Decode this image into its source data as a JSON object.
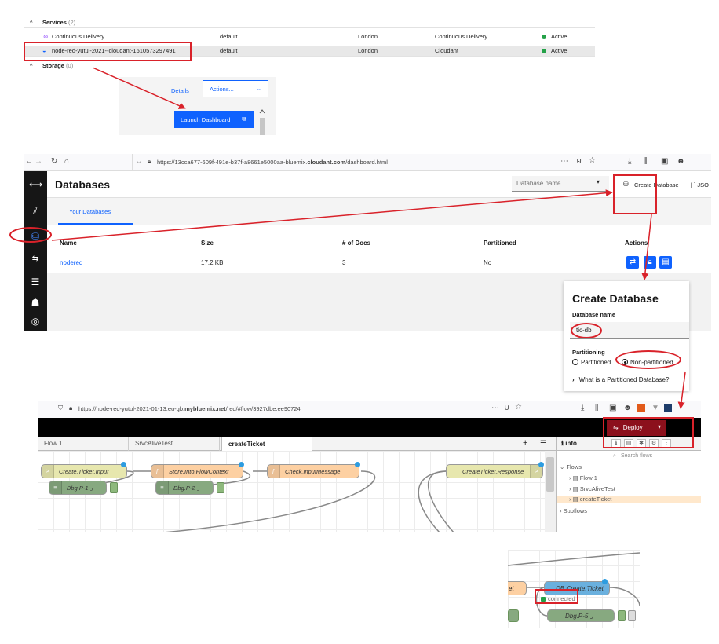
{
  "resource_list": {
    "services_header": "Services",
    "services_count": "(2)",
    "storage_header": "Storage",
    "storage_count": "(0)",
    "rows": [
      {
        "name": "Continuous Delivery",
        "group": "default",
        "location": "London",
        "offering": "Continuous Delivery",
        "status": "Active"
      },
      {
        "name": "node-red-yutul-2021--cloudant-1610573297491",
        "group": "default",
        "location": "London",
        "offering": "Cloudant",
        "status": "Active"
      }
    ],
    "details_label": "Details",
    "actions_label": "Actions...",
    "launch_label": "Launch Dashboard",
    "status_color": "#24a148"
  },
  "cloudant": {
    "url": "https://13cca677-609f-491e-b37f-a8661e5000aa-bluemix.cloudant.com/dashboard.html",
    "url_prefix": "https://13cca677-609f-491e-b37f-a8661e5000aa-bluemix.",
    "url_bold": "cloudant.com",
    "url_suffix": "/dashboard.html",
    "page_title": "Databases",
    "db_name_placeholder": "Database name",
    "create_label": "Create Database",
    "json_label": "[ ] JSO",
    "tab_label": "Your Databases",
    "columns": [
      "Name",
      "Size",
      "# of Docs",
      "Partitioned",
      "Actions"
    ],
    "row": {
      "name": "nodered",
      "size": "17.2 KB",
      "docs": "3",
      "partitioned": "No"
    }
  },
  "create_db": {
    "title": "Create Database",
    "name_label": "Database name",
    "name_value": "tic-db",
    "partitioning_label": "Partitioning",
    "opt_partitioned": "Partitioned",
    "opt_non_partitioned": "Non-partitioned",
    "selected": "Non-partitioned",
    "help_link": "What is a Partitioned Database?"
  },
  "nodered": {
    "url_prefix": "https://node-red-yutul-2021-01-13.eu-gb.",
    "url_bold": "mybluemix.net",
    "url_suffix": "/red/#flow/3927dbe.ee90724",
    "deploy_label": "Deploy",
    "tabs": [
      "Flow 1",
      "SrvcAliveTest",
      "createTicket"
    ],
    "active_tab": "createTicket",
    "sidebar_tab": "info",
    "search_placeholder": "Search flows",
    "tree": {
      "flows_label": "Flows",
      "items": [
        "Flow 1",
        "SrvcAliveTest",
        "createTicket"
      ],
      "subflows_label": "Subflows"
    },
    "nodes": {
      "create_input": "Create.Ticket.Input",
      "store": "Store.Into.FlowContext",
      "check": "Check.InputMessage",
      "response": "CreateTicket.Response",
      "dbg1": "Dbg.P-1",
      "dbg2": "Dbg.P-2"
    }
  },
  "zoom": {
    "partial_label": "et",
    "db_node": "DB.Create.Ticket",
    "status": "connected",
    "dbg5": "Dbg.P-5"
  }
}
